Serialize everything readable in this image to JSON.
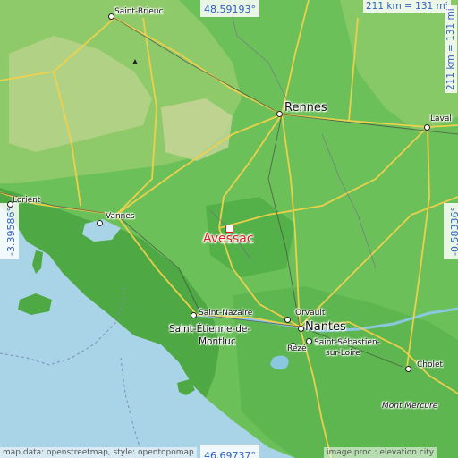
{
  "map": {
    "place": "Avessac",
    "coords": {
      "north": "48.59193°",
      "south": "46.69737°",
      "west": "-3.39586°",
      "east": "-0.58336°"
    },
    "scale_horizontal": "211 km = 131 mi",
    "scale_vertical": "211 km = 131 mi",
    "attribution_left": "map data: openstreetmap, style: opentopomap",
    "attribution_right": "image proc.: elevation.city"
  },
  "cities": {
    "saint_brieuc": "Saint-Brieuc",
    "rennes": "Rennes",
    "laval": "Laval",
    "lorient": "Lorient",
    "vannes": "Vannes",
    "saint_nazaire": "Saint-Nazaire",
    "saint_etienne_1": "Saint-Étienne-de-",
    "saint_etienne_2": "Montluc",
    "orvault": "Orvault",
    "nantes": "Nantes",
    "reze": "Rezé",
    "saint_sebastien_1": "Saint-Sébastien-",
    "saint_sebastien_2": "sur-Loire",
    "cholet": "Cholet",
    "mont_mercure": "Mont Mercure"
  },
  "colors": {
    "water": "#a9d3e6",
    "lowland": "#6cc05a",
    "midland": "#4ea843",
    "upland": "#9fd07a",
    "highland": "#c9d59a",
    "road": "#f2d14b",
    "marker": "#e02020",
    "coord_text": "#3060c0"
  },
  "icons": {
    "city_marker": "circle-dot-icon",
    "place_marker": "square-marker-icon"
  }
}
